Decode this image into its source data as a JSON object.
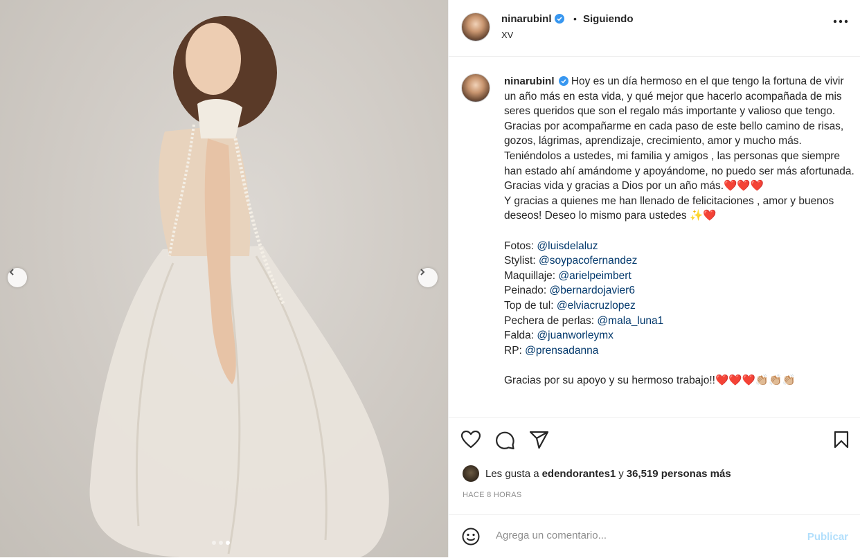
{
  "post": {
    "username": "ninarubinl",
    "separator": "•",
    "follow_status": "Siguiendo",
    "subtitle": "XV",
    "verified": true
  },
  "carousel": {
    "prev_icon": "chevron-left-icon",
    "next_icon": "chevron-right-icon",
    "total_slides": 3,
    "active_slide": 3
  },
  "caption": {
    "username": "ninarubinl",
    "lines": [
      "Hoy es un día hermoso en el que tengo la fortuna de vivir un año más en esta vida, y qué mejor que hacerlo acompañada de mis seres queridos que son el regalo más importante y valioso que tengo. Gracias por acompañarme en cada paso de este bello camino de risas, gozos, lágrimas, aprendizaje, crecimiento, amor y mucho más. Teniéndolos a ustedes, mi familia y amigos , las personas que siempre han estado ahí amándome y apoyándome, no puedo ser más afortunada. Gracias vida y gracias a Dios por un año más.",
      "❤️❤️❤️"
    ],
    "line2": "Y gracias a quienes me han llenado de felicitaciones , amor y buenos deseos! Deseo lo mismo para ustedes",
    "line2_emoji": "✨❤️",
    "credits": [
      {
        "label": "Fotos:",
        "handle": "@luisdelaluz"
      },
      {
        "label": "Stylist:",
        "handle": "@soypacofernandez"
      },
      {
        "label": "Maquillaje:",
        "handle": "@arielpeimbert"
      },
      {
        "label": "Peinado:",
        "handle": "@bernardojavier6"
      },
      {
        "label": "Top de tul:",
        "handle": "@elviacruzlopez"
      },
      {
        "label": "Pechera de perlas:",
        "handle": "@mala_luna1"
      },
      {
        "label": "Falda:",
        "handle": "@juanworleymx"
      },
      {
        "label": "RP:",
        "handle": "@prensadanna"
      }
    ],
    "closing": "Gracias por su apoyo y su hermoso trabajo!!",
    "closing_emoji": "❤️❤️❤️👏🏼👏🏼👏🏼"
  },
  "actions": {
    "like_icon": "heart-icon",
    "comment_icon": "comment-bubble-icon",
    "share_icon": "paper-plane-icon",
    "save_icon": "bookmark-icon"
  },
  "likes": {
    "prefix": "Les gusta a",
    "user": "edendorantes1",
    "middle": "y",
    "count_text": "36,519 personas más"
  },
  "timestamp": "HACE 8 HORAS",
  "comment": {
    "placeholder": "Agrega un comentario...",
    "publish_label": "Publicar",
    "emoji_icon": "smiley-face-icon"
  },
  "colors": {
    "link": "#00376b",
    "verified": "#3897f0",
    "publish_disabled": "#b2dffc",
    "muted": "#8e8e8e"
  }
}
